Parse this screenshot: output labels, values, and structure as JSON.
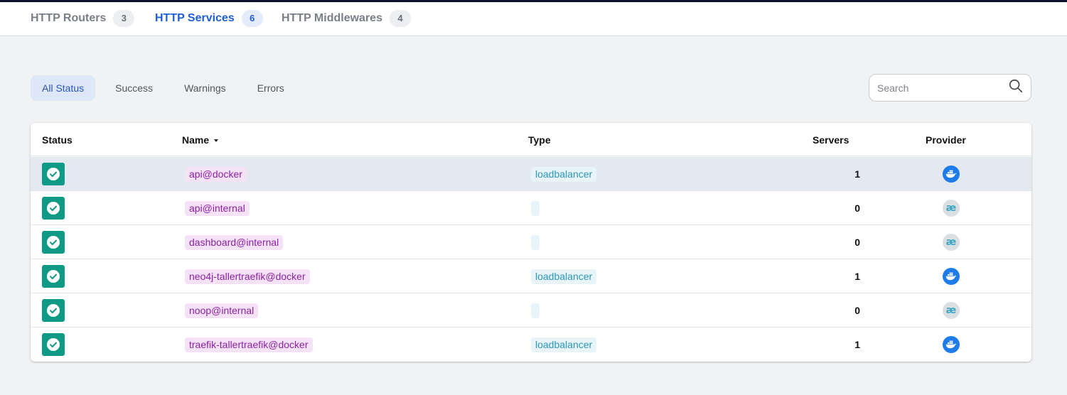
{
  "tabs": [
    {
      "label": "HTTP Routers",
      "count": "3"
    },
    {
      "label": "HTTP Services",
      "count": "6"
    },
    {
      "label": "HTTP Middlewares",
      "count": "4"
    }
  ],
  "filters": [
    "All Status",
    "Success",
    "Warnings",
    "Errors"
  ],
  "search": {
    "placeholder": "Search",
    "icon": "search-icon"
  },
  "table": {
    "headers": {
      "status": "Status",
      "name": "Name",
      "type": "Type",
      "servers": "Servers",
      "provider": "Provider"
    },
    "rows": [
      {
        "status": "success",
        "name": "api@docker",
        "type": "loadbalancer",
        "servers": "1",
        "provider": "docker"
      },
      {
        "status": "success",
        "name": "api@internal",
        "type": "",
        "servers": "0",
        "provider": "internal"
      },
      {
        "status": "success",
        "name": "dashboard@internal",
        "type": "",
        "servers": "0",
        "provider": "internal"
      },
      {
        "status": "success",
        "name": "neo4j-tallertraefik@docker",
        "type": "loadbalancer",
        "servers": "1",
        "provider": "docker"
      },
      {
        "status": "success",
        "name": "noop@internal",
        "type": "",
        "servers": "0",
        "provider": "internal"
      },
      {
        "status": "success",
        "name": "traefik-tallertraefik@docker",
        "type": "loadbalancer",
        "servers": "1",
        "provider": "docker"
      }
    ]
  },
  "provider_glyphs": {
    "internal": "æ"
  },
  "colors": {
    "accent": "#1f5fd6",
    "success": "#0f9a86",
    "docker": "#1d7bea",
    "name_text": "#8a22a3",
    "type_text": "#2a97b8"
  }
}
